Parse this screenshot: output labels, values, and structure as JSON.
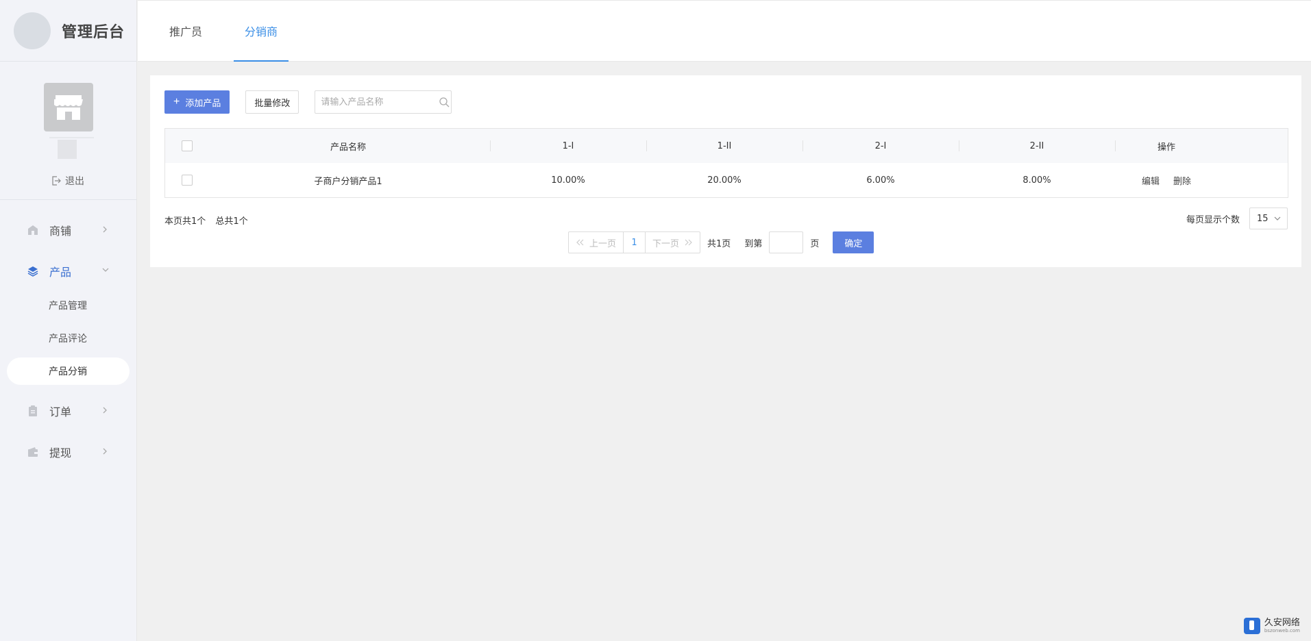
{
  "brand": {
    "title": "管理后台"
  },
  "profile": {
    "logout_label": "退出"
  },
  "menu": {
    "items": [
      {
        "label": "商铺",
        "icon": "store-icon"
      },
      {
        "label": "产品",
        "icon": "layers-icon",
        "expanded": true
      },
      {
        "label": "订单",
        "icon": "clipboard-icon"
      },
      {
        "label": "提现",
        "icon": "wallet-icon"
      }
    ],
    "product_sub": [
      {
        "label": "产品管理"
      },
      {
        "label": "产品评论"
      },
      {
        "label": "产品分销",
        "active": true
      }
    ]
  },
  "tabs": [
    {
      "label": "推广员"
    },
    {
      "label": "分销商",
      "active": true
    }
  ],
  "toolbar": {
    "add_label": "添加产品",
    "batch_label": "批量修改",
    "search_placeholder": "请输入产品名称"
  },
  "table": {
    "headers": [
      "产品名称",
      "1-I",
      "1-II",
      "2-I",
      "2-II",
      "操作"
    ],
    "rows": [
      {
        "name": "子商户分销产品1",
        "c1": "10.00%",
        "c2": "20.00%",
        "c3": "6.00%",
        "c4": "8.00%",
        "edit": "编辑",
        "delete": "删除"
      }
    ]
  },
  "pager": {
    "page_count_text": "本页共1个",
    "total_text": "总共1个",
    "prev_label": "上一页",
    "current_page": "1",
    "next_label": "下一页",
    "total_pages_text": "共1页",
    "goto_label": "到第",
    "unit_label": "页",
    "confirm_label": "确定",
    "page_size_label": "每页显示个数",
    "page_size_value": "15"
  },
  "watermark": {
    "title": "久安网络",
    "sub": "bszonweb.com"
  },
  "colors": {
    "primary": "#5b7fe0",
    "accent": "#3a8ee6",
    "menu_active": "#3a6fd0"
  }
}
